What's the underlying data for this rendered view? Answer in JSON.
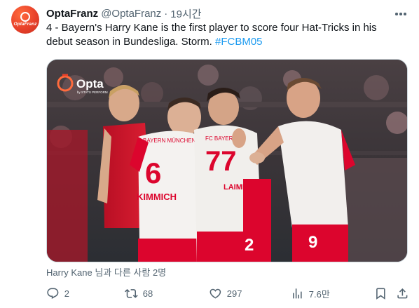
{
  "author": {
    "avatar_label": "OptaFranz",
    "name": "OptaFranz",
    "handle": "@OptaFranz",
    "separator": "·",
    "time": "19시간"
  },
  "tweet": {
    "text_main": "4 - Bayern's Harry Kane is the first player to score four Hat-Tricks in his debut season in Bundesliga. Storm. ",
    "hashtag": "#FCBM05"
  },
  "media": {
    "watermark_brand": "Opta",
    "watermark_sub": "by STATS PERFORM",
    "shirt_text_left": "BAYERN MÜNCHEN",
    "shirt_number_left": "6",
    "shirt_name_left": "KIMMICH",
    "shirt_text_mid": "FC BAYERN",
    "shirt_number_mid": "77",
    "shirt_name_mid": "LAIMER",
    "shirt_number_right": "9",
    "shirt_number_partial": "2"
  },
  "tagged": {
    "text": "Harry Kane 님과 다른 사람 2명"
  },
  "actions": {
    "replies": "2",
    "retweets": "68",
    "likes": "297",
    "views": "7.6만"
  },
  "icons": {
    "avatar": "opta-logo-icon",
    "more": "more-dots-icon",
    "tag": "person-icon",
    "reply": "reply-icon",
    "retweet": "retweet-icon",
    "like": "heart-icon",
    "views": "views-chart-icon",
    "bookmark": "bookmark-icon",
    "share": "share-icon"
  },
  "colors": {
    "link": "#1d9bf0",
    "secondary_text": "#536471",
    "primary_text": "#0f1419",
    "brand_red": "#e8412a",
    "bayern_red": "#dc052d"
  }
}
